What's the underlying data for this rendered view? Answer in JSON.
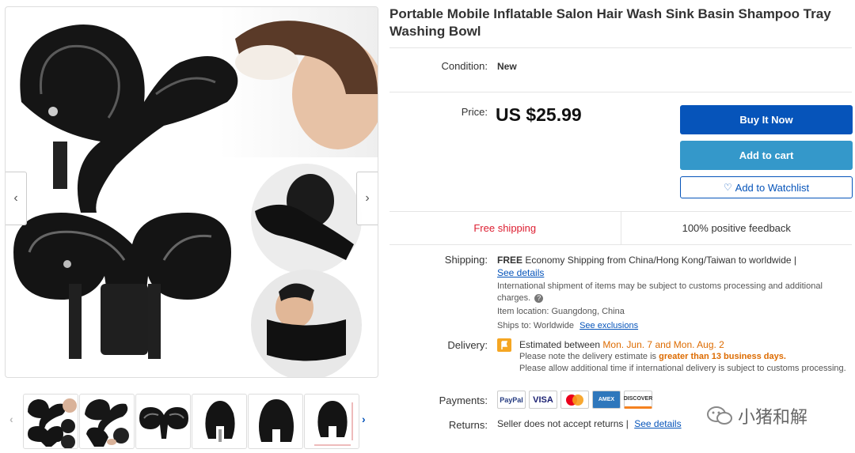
{
  "listing": {
    "title": "Portable Mobile Inflatable Salon Hair Wash Sink Basin Shampoo Tray Washing Bowl"
  },
  "gallery": {
    "prev_arrow": "‹",
    "next_arrow": "›",
    "thumb_prev": "‹",
    "thumb_next": "›",
    "thumbnail_count": 6
  },
  "details": {
    "condition_label": "Condition:",
    "condition_value": "New",
    "price_label": "Price:",
    "price_value": "US $25.99"
  },
  "actions": {
    "buy_now": "Buy It Now",
    "add_to_cart": "Add to cart",
    "watchlist": "Add to Watchlist",
    "watchlist_icon": "heart-icon"
  },
  "features": {
    "shipping": "Free shipping",
    "feedback": "100% positive feedback"
  },
  "shipping": {
    "label": "Shipping:",
    "free": "FREE",
    "method": "Economy Shipping from China/Hong Kong/Taiwan to worldwide |",
    "see_details": "See details",
    "customs_note": "International shipment of items may be subject to customs processing and additional charges.",
    "help_icon": "question-circle-icon",
    "location_label": "Item location:",
    "location_value": "Guangdong, China",
    "ships_to_label": "Ships to:",
    "ships_to_value": "Worldwide",
    "see_exclusions": "See exclusions"
  },
  "delivery": {
    "label": "Delivery:",
    "flag_icon": "orange-flag-icon",
    "estimated_prefix": "Estimated between",
    "estimated_range": "Mon. Jun. 7 and Mon. Aug. 2",
    "note_prefix": "Please note the delivery estimate is",
    "note_highlight": "greater than 13 business days.",
    "allow_note": "Please allow additional time if international delivery is subject to customs processing."
  },
  "payments": {
    "label": "Payments:",
    "methods": [
      "PayPal",
      "VISA",
      "Mastercard",
      "AMEX",
      "DISCOVER"
    ]
  },
  "returns": {
    "label": "Returns:",
    "value": "Seller does not accept returns |",
    "see_details": "See details"
  },
  "watermark": {
    "text": "小猪和解"
  },
  "colors": {
    "buy_blue": "#0654ba",
    "cart_blue": "#3498ca",
    "free_shipping_red": "#dd1e31",
    "highlight_orange": "#dd6b00"
  }
}
